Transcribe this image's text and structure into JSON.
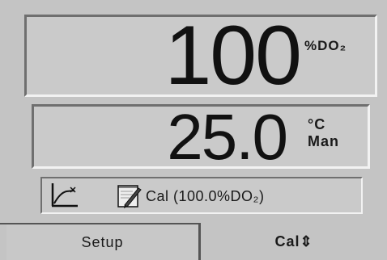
{
  "display": {
    "do_value": "100",
    "do_unit": "%DO₂",
    "temp_value": "25.0",
    "temp_unit": "°C",
    "temp_mode": "Man",
    "status_text": "Cal (100.0%DO₂)"
  },
  "icons": {
    "graph": "graph-stability-icon",
    "calibration": "calibration-notepad-icon"
  },
  "tabs": [
    {
      "label": "Setup"
    },
    {
      "label": "Cal⇕"
    }
  ]
}
